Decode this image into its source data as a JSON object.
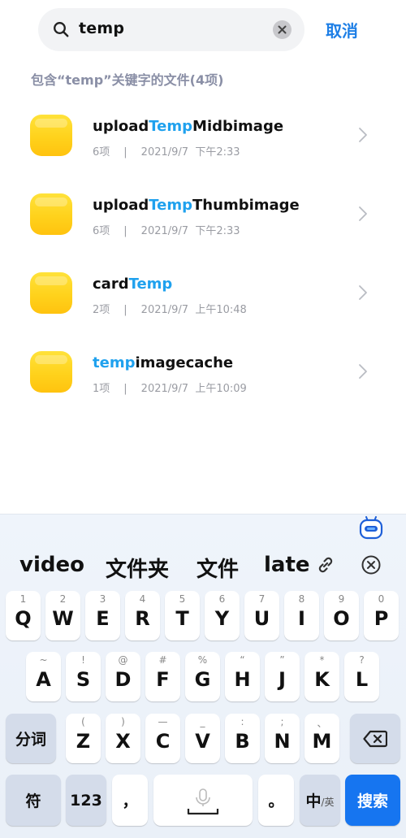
{
  "search": {
    "query": "temp",
    "cancel_label": "取消"
  },
  "results_header": "包含“temp”关键字的文件(4项)",
  "files": [
    {
      "name_before": "upload",
      "name_match": "Temp",
      "name_after": "Midbimage",
      "count": "6项",
      "sep": "|",
      "date": "2021/9/7",
      "time": "下午2:33"
    },
    {
      "name_before": "upload",
      "name_match": "Temp",
      "name_after": "Thumbimage",
      "count": "6项",
      "sep": "|",
      "date": "2021/9/7",
      "time": "下午2:33"
    },
    {
      "name_before": "card",
      "name_match": "Temp",
      "name_after": "",
      "count": "2项",
      "sep": "|",
      "date": "2021/9/7",
      "time": "上午10:48"
    },
    {
      "name_before": "",
      "name_match": "temp",
      "name_after": "imagecache",
      "count": "1项",
      "sep": "|",
      "date": "2021/9/7",
      "time": "上午10:09"
    }
  ],
  "keyboard": {
    "candidates": [
      "video",
      "文件夹",
      "文件",
      "late"
    ],
    "row1": [
      {
        "key": "Q",
        "sup": "1"
      },
      {
        "key": "W",
        "sup": "2"
      },
      {
        "key": "E",
        "sup": "3"
      },
      {
        "key": "R",
        "sup": "4"
      },
      {
        "key": "T",
        "sup": "5"
      },
      {
        "key": "Y",
        "sup": "6"
      },
      {
        "key": "U",
        "sup": "7"
      },
      {
        "key": "I",
        "sup": "8"
      },
      {
        "key": "O",
        "sup": "9"
      },
      {
        "key": "P",
        "sup": "0"
      }
    ],
    "row2": [
      {
        "key": "A",
        "sup": "~"
      },
      {
        "key": "S",
        "sup": "!"
      },
      {
        "key": "D",
        "sup": "@"
      },
      {
        "key": "F",
        "sup": "#"
      },
      {
        "key": "G",
        "sup": "%"
      },
      {
        "key": "H",
        "sup": "“"
      },
      {
        "key": "J",
        "sup": "”"
      },
      {
        "key": "K",
        "sup": "*"
      },
      {
        "key": "L",
        "sup": "?"
      }
    ],
    "row3": [
      {
        "key": "Z",
        "sup": "("
      },
      {
        "key": "X",
        "sup": ")"
      },
      {
        "key": "C",
        "sup": "—"
      },
      {
        "key": "V",
        "sup": "_"
      },
      {
        "key": "B",
        "sup": ":"
      },
      {
        "key": "N",
        "sup": ";"
      },
      {
        "key": "M",
        "sup": "、"
      }
    ],
    "fenci_label": "分词",
    "symbol_label": "符",
    "num_label": "123",
    "comma_label": "，",
    "period_label": "。",
    "lang_main": "中",
    "lang_sub": "/英",
    "search_label": "搜索"
  },
  "colors": {
    "accent_blue": "#1e7fe6",
    "highlight": "#1fa1ee",
    "folder_yellow": "#ffd21c",
    "search_key": "#1675f0"
  }
}
